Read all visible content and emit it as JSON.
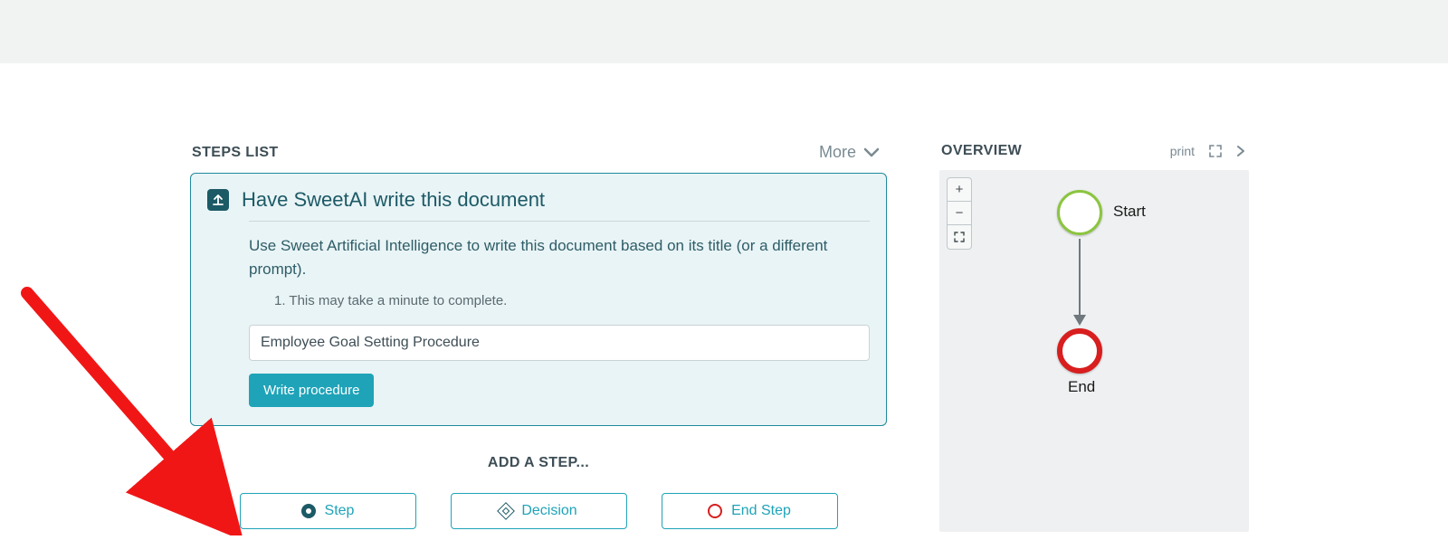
{
  "steps": {
    "heading": "STEPS LIST",
    "more_label": "More",
    "card": {
      "title": "Have SweetAI write this document",
      "description": "Use Sweet Artificial Intelligence to write this document based on its title (or a different prompt).",
      "note_ordinal": "1. ",
      "note_text": "This may take a minute to complete.",
      "input_value": "Employee Goal Setting Procedure",
      "button_label": "Write procedure"
    },
    "add_heading": "ADD A STEP...",
    "buttons": {
      "step": "Step",
      "decision": "Decision",
      "end": "End Step"
    }
  },
  "overview": {
    "heading": "OVERVIEW",
    "print_label": "print",
    "zoom": {
      "in": "+",
      "out": "−"
    },
    "nodes": {
      "start": "Start",
      "end": "End"
    }
  }
}
